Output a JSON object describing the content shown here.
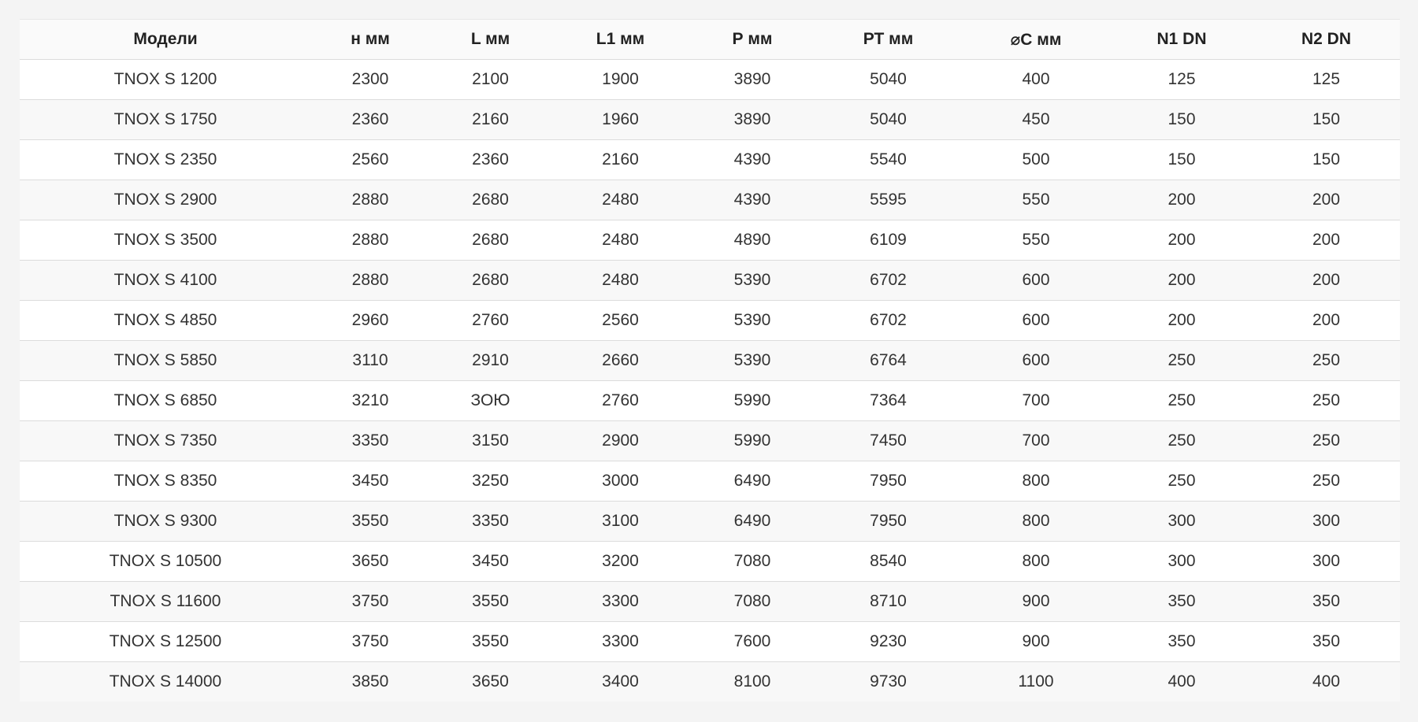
{
  "table": {
    "headers": [
      "Модели",
      "н мм",
      "L мм",
      "L1 мм",
      "Р мм",
      "РТ мм",
      "⌀С мм",
      "N1 DN",
      "N2 DN"
    ],
    "rows": [
      [
        "TNOX S 1200",
        "2300",
        "2100",
        "1900",
        "3890",
        "5040",
        "400",
        "125",
        "125"
      ],
      [
        "TNOX S 1750",
        "2360",
        "2160",
        "1960",
        "3890",
        "5040",
        "450",
        "150",
        "150"
      ],
      [
        "TNOX S 2350",
        "2560",
        "2360",
        "2160",
        "4390",
        "5540",
        "500",
        "150",
        "150"
      ],
      [
        "TNOX S 2900",
        "2880",
        "2680",
        "2480",
        "4390",
        "5595",
        "550",
        "200",
        "200"
      ],
      [
        "TNOX S 3500",
        "2880",
        "2680",
        "2480",
        "4890",
        "6109",
        "550",
        "200",
        "200"
      ],
      [
        "TNOX S 4100",
        "2880",
        "2680",
        "2480",
        "5390",
        "6702",
        "600",
        "200",
        "200"
      ],
      [
        "TNOX S 4850",
        "2960",
        "2760",
        "2560",
        "5390",
        "6702",
        "600",
        "200",
        "200"
      ],
      [
        "TNOX S 5850",
        "3110",
        "2910",
        "2660",
        "5390",
        "6764",
        "600",
        "250",
        "250"
      ],
      [
        "TNOX S 6850",
        "3210",
        "ЗОЮ",
        "2760",
        "5990",
        "7364",
        "700",
        "250",
        "250"
      ],
      [
        "TNOX S 7350",
        "3350",
        "3150",
        "2900",
        "5990",
        "7450",
        "700",
        "250",
        "250"
      ],
      [
        "TNOX S 8350",
        "3450",
        "3250",
        "3000",
        "6490",
        "7950",
        "800",
        "250",
        "250"
      ],
      [
        "TNOX S 9300",
        "3550",
        "3350",
        "3100",
        "6490",
        "7950",
        "800",
        "300",
        "300"
      ],
      [
        "TNOX S 10500",
        "3650",
        "3450",
        "3200",
        "7080",
        "8540",
        "800",
        "300",
        "300"
      ],
      [
        "TNOX S 11600",
        "3750",
        "3550",
        "3300",
        "7080",
        "8710",
        "900",
        "350",
        "350"
      ],
      [
        "TNOX S 12500",
        "3750",
        "3550",
        "3300",
        "7600",
        "9230",
        "900",
        "350",
        "350"
      ],
      [
        "TNOX S 14000",
        "3850",
        "3650",
        "3400",
        "8100",
        "9730",
        "1100",
        "400",
        "400"
      ]
    ]
  }
}
